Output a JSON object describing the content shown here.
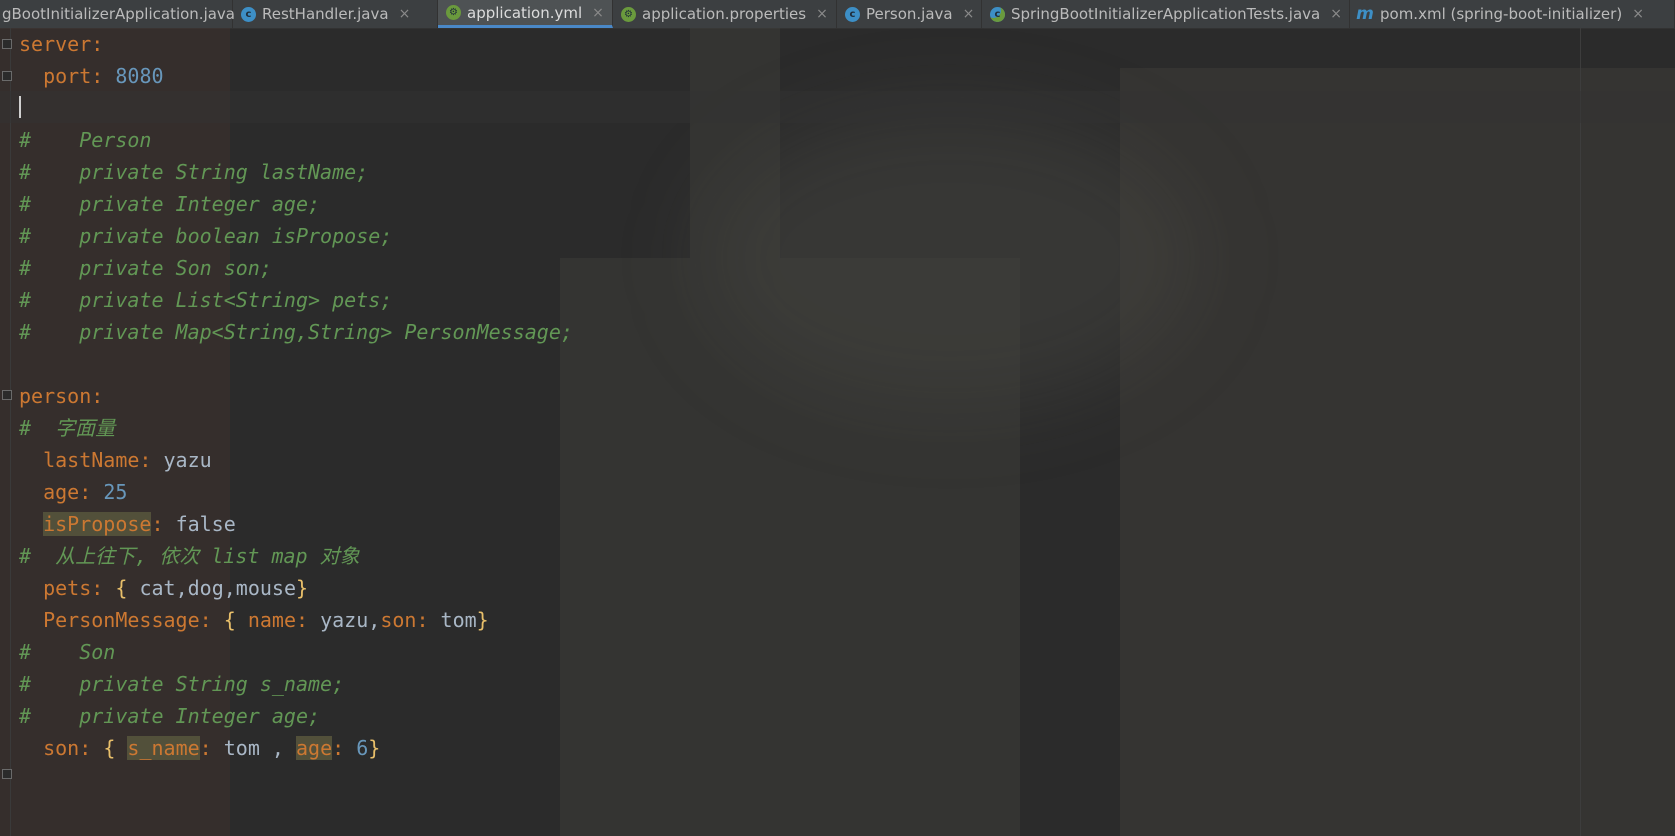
{
  "tabs": [
    {
      "label": "gBootInitializerApplication.java",
      "icon": "java-class-icon"
    },
    {
      "label": "RestHandler.java",
      "icon": "java-class-icon"
    },
    {
      "label": "application.yml",
      "icon": "spring-config-icon",
      "active": true
    },
    {
      "label": "application.properties",
      "icon": "spring-config-icon"
    },
    {
      "label": "Person.java",
      "icon": "java-class-icon"
    },
    {
      "label": "SpringBootInitializerApplicationTests.java",
      "icon": "java-test-icon"
    },
    {
      "label": "pom.xml (spring-boot-initializer)",
      "icon": "maven-icon"
    }
  ],
  "tab_close_glyph": "×",
  "tab_icon_letters": {
    "java": "c",
    "spring": "⚙",
    "maven": "m"
  },
  "code": {
    "server_key": "server",
    "port_key": "port",
    "port_val": "8080",
    "c1_hash": "#",
    "c1_text": "Person",
    "c2_text": "private String lastName;",
    "c3_text": "private Integer age;",
    "c4_text": "private boolean isPropose;",
    "c5_text": "private Son son;",
    "c6_text": "private List<String> pets;",
    "c7_text": "private Map<String,String> PersonMessage;",
    "person_key": "person",
    "c8_text": "字面量",
    "lastName_key": "lastName",
    "lastName_val": "yazu",
    "age_key": "age",
    "age_val": "25",
    "isPropose_key": "isPropose",
    "isPropose_val": "false",
    "c9_text": "从上往下, 依次 list map 对象",
    "pets_key": "pets",
    "pets_val": "cat,dog,mouse",
    "pm_key": "PersonMessage",
    "pm_name_key": "name",
    "pm_name_val": "yazu",
    "pm_son_key": "son",
    "pm_son_val": "tom",
    "c10_text": "Son",
    "c11_text": "private String s_name;",
    "c12_text": "private Integer age;",
    "son_key": "son",
    "son_sname_key": "s_name",
    "son_sname_val": "tom",
    "son_age_key": "age",
    "son_age_val": "6"
  },
  "colors": {
    "key": "#cc7832",
    "number": "#6897bb",
    "comment": "#629755",
    "brace": "#e8bf6a",
    "text": "#a9b7c6",
    "active_tab_underline": "#4a88c7"
  }
}
